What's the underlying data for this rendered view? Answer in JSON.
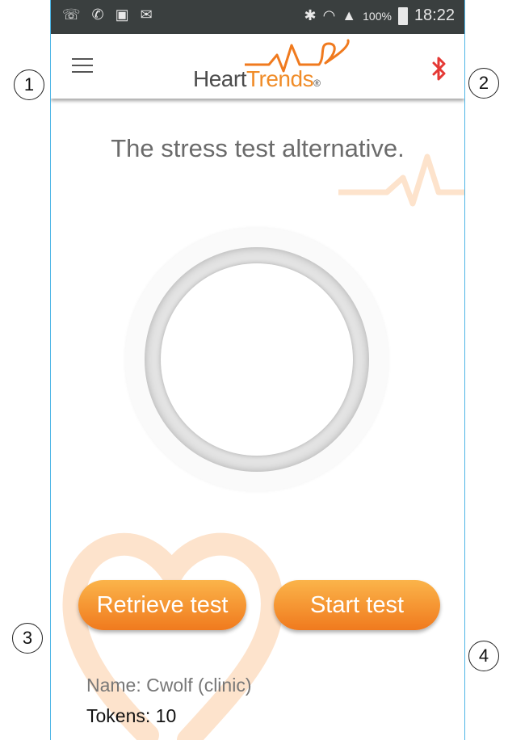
{
  "status_bar": {
    "battery_percent": "100%",
    "time": "18:22"
  },
  "header": {
    "logo_text_bold": "Heart",
    "logo_text_thin": "Trends",
    "logo_mark": "®"
  },
  "main": {
    "tagline": "The stress test alternative.",
    "retrieve_button": "Retrieve test",
    "start_button": "Start test",
    "name_line": "Name: Cwolf (clinic)",
    "tokens_line": "Tokens: 10"
  },
  "callouts": [
    "1",
    "2",
    "3",
    "4"
  ],
  "icons": {
    "menu": "hamburger-icon",
    "bluetooth": "bluetooth-icon"
  },
  "colors": {
    "accent_orange": "#f07a1e",
    "bluetooth_red": "#e53935",
    "status_bar": "#3a3f3f"
  }
}
